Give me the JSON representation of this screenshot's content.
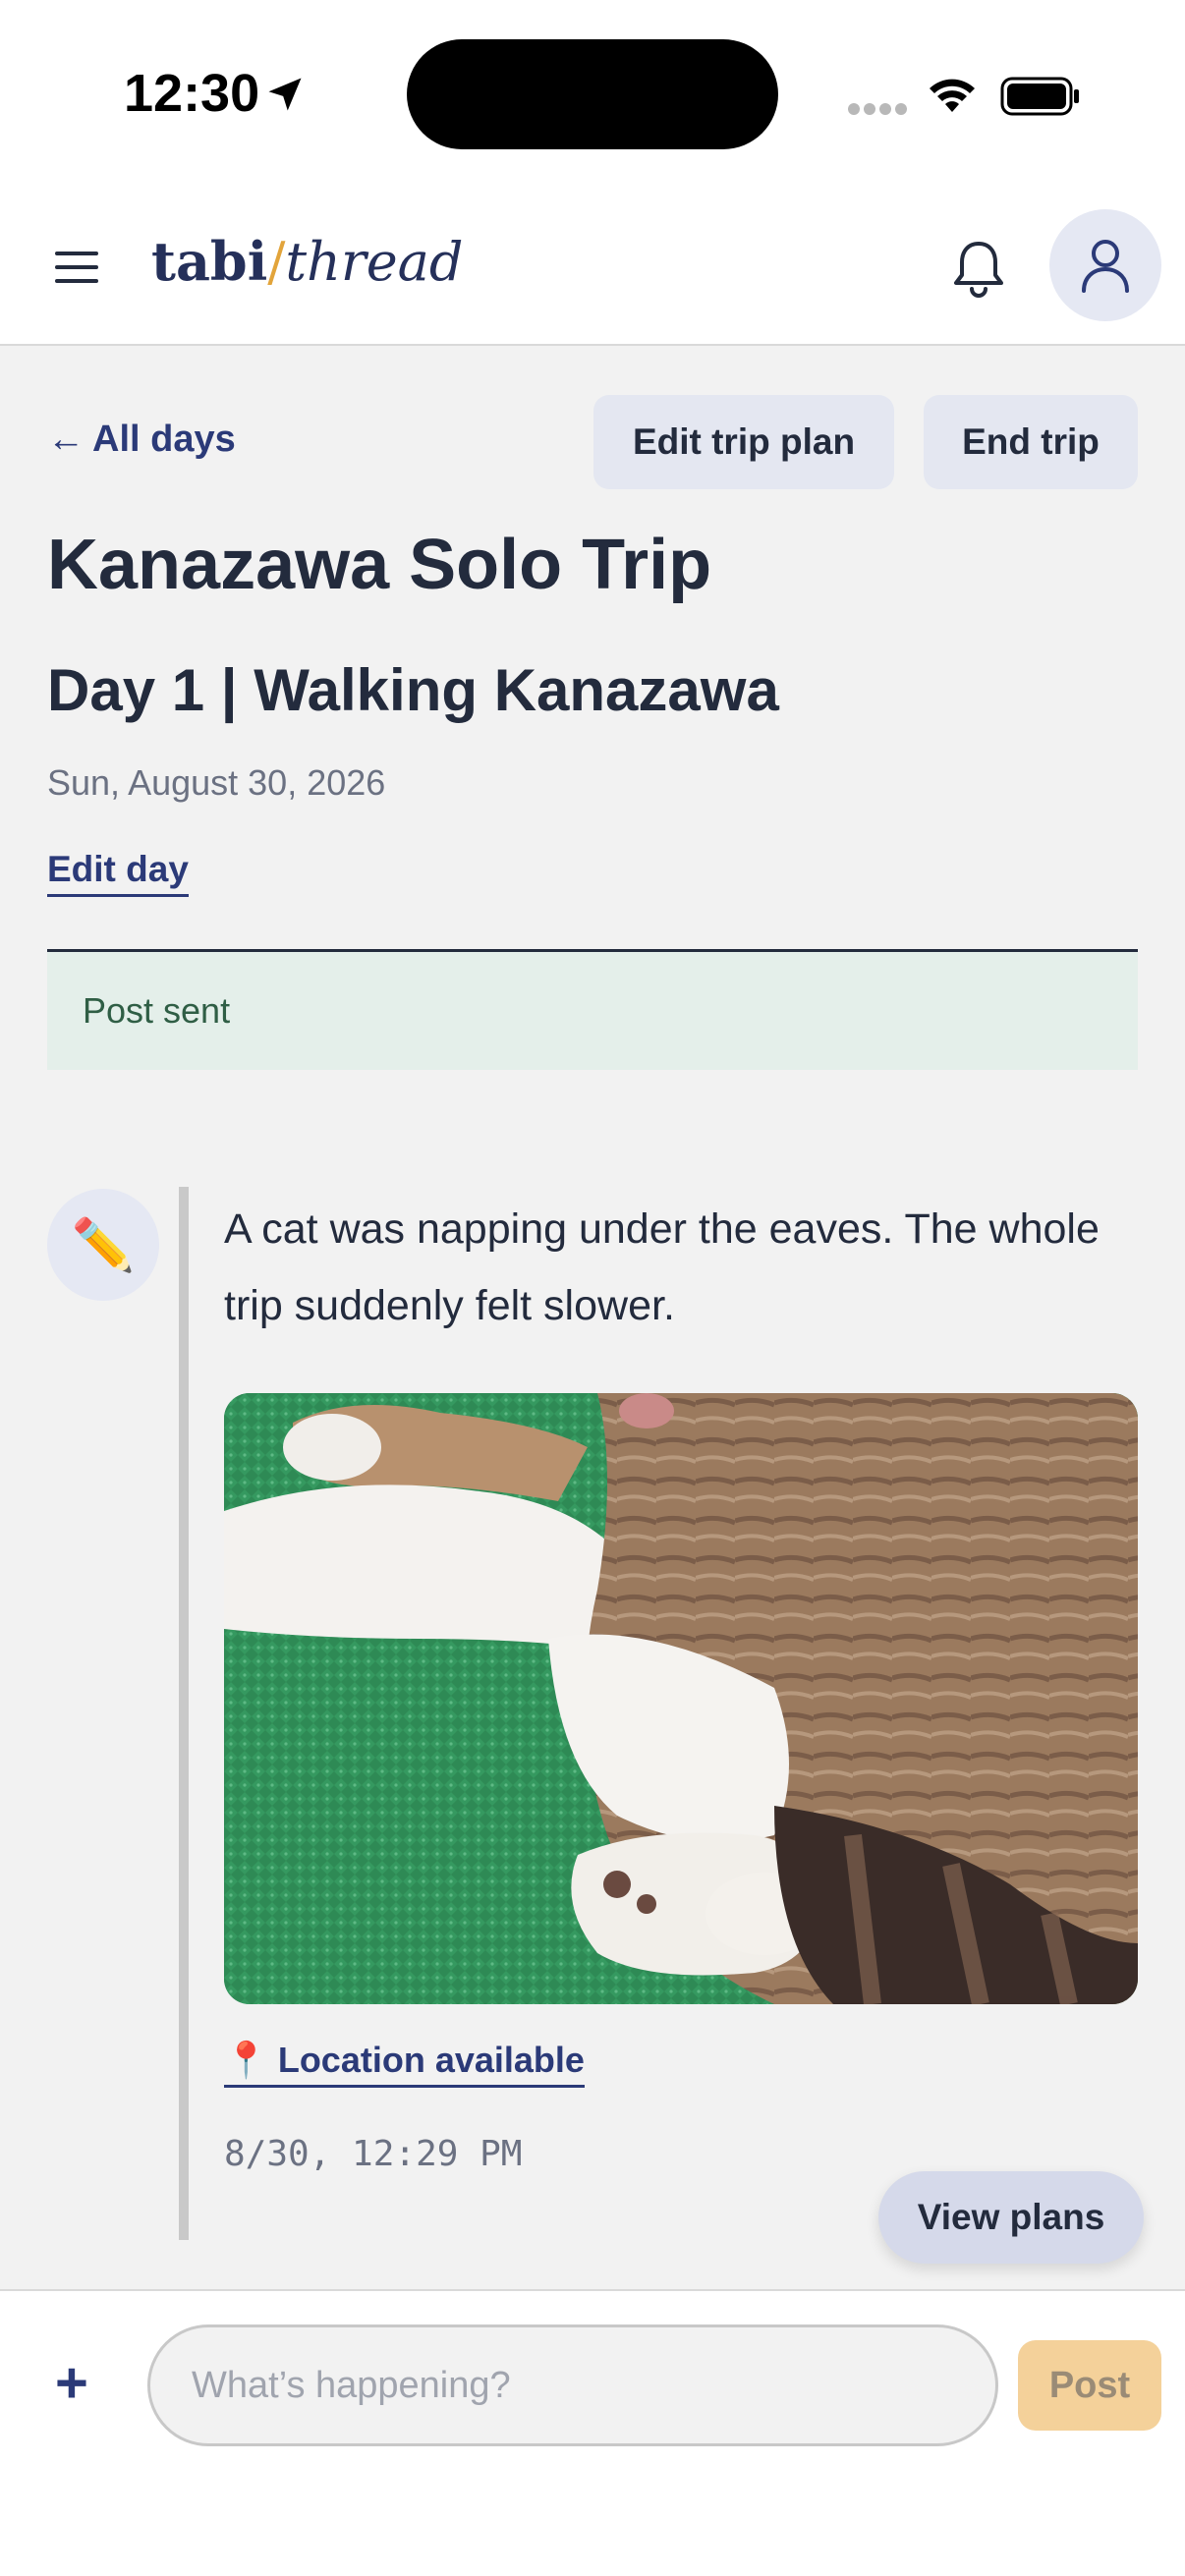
{
  "status_bar": {
    "time": "12:30"
  },
  "header": {
    "logo_left": "tabi",
    "logo_slash": "/",
    "logo_right": "thread"
  },
  "nav": {
    "back_arrow": "←",
    "back_label": "All days",
    "edit_trip_plan": "Edit trip plan",
    "end_trip": "End trip"
  },
  "trip": {
    "title": "Kanazawa Solo Trip",
    "day_title": "Day 1 | Walking Kanazawa",
    "date": "Sun, August 30, 2026",
    "edit_day": "Edit day"
  },
  "notice": "Post sent",
  "post": {
    "badge_icon": "✏️",
    "text": "A cat was napping under the eaves. The whole trip suddenly felt slower.",
    "location_icon": "📍",
    "location_label": "Location available",
    "timestamp": "8/30, 12:29 PM"
  },
  "floating": {
    "view_plans": "View plans"
  },
  "composer": {
    "plus": "+",
    "placeholder": "What’s happening?",
    "post_label": "Post"
  },
  "colors": {
    "accent": "#2b3a78",
    "logo_slash": "#e2a43b",
    "notice_bg": "#e4efea",
    "post_button_bg": "#f4d19a"
  }
}
